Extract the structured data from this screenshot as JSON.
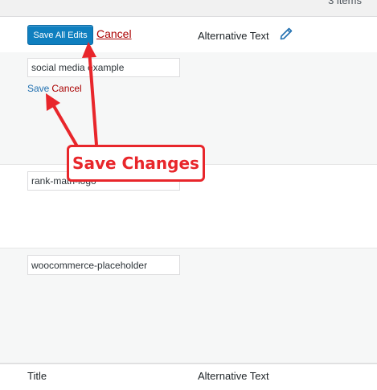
{
  "header": {
    "items_count": "3 items",
    "save_all_label": "Save All Edits",
    "cancel_label": "Cancel",
    "alt_text_header": "Alternative Text",
    "edit_icon": "pencil-icon"
  },
  "rows": [
    {
      "title_value": "social media example",
      "save_label": "Save",
      "cancel_label": "Cancel"
    },
    {
      "title_value": "rank-math-logo"
    },
    {
      "title_value": "woocommerce-placeholder"
    }
  ],
  "footer": {
    "title_header": "Title",
    "alt_text_header": "Alternative Text"
  },
  "annotation": {
    "callout_text": "Save Changes",
    "color": "#e8262b"
  },
  "colors": {
    "primary_button": "#0f7fbf",
    "cancel_link": "#aa0000",
    "save_link": "#2271b1"
  }
}
